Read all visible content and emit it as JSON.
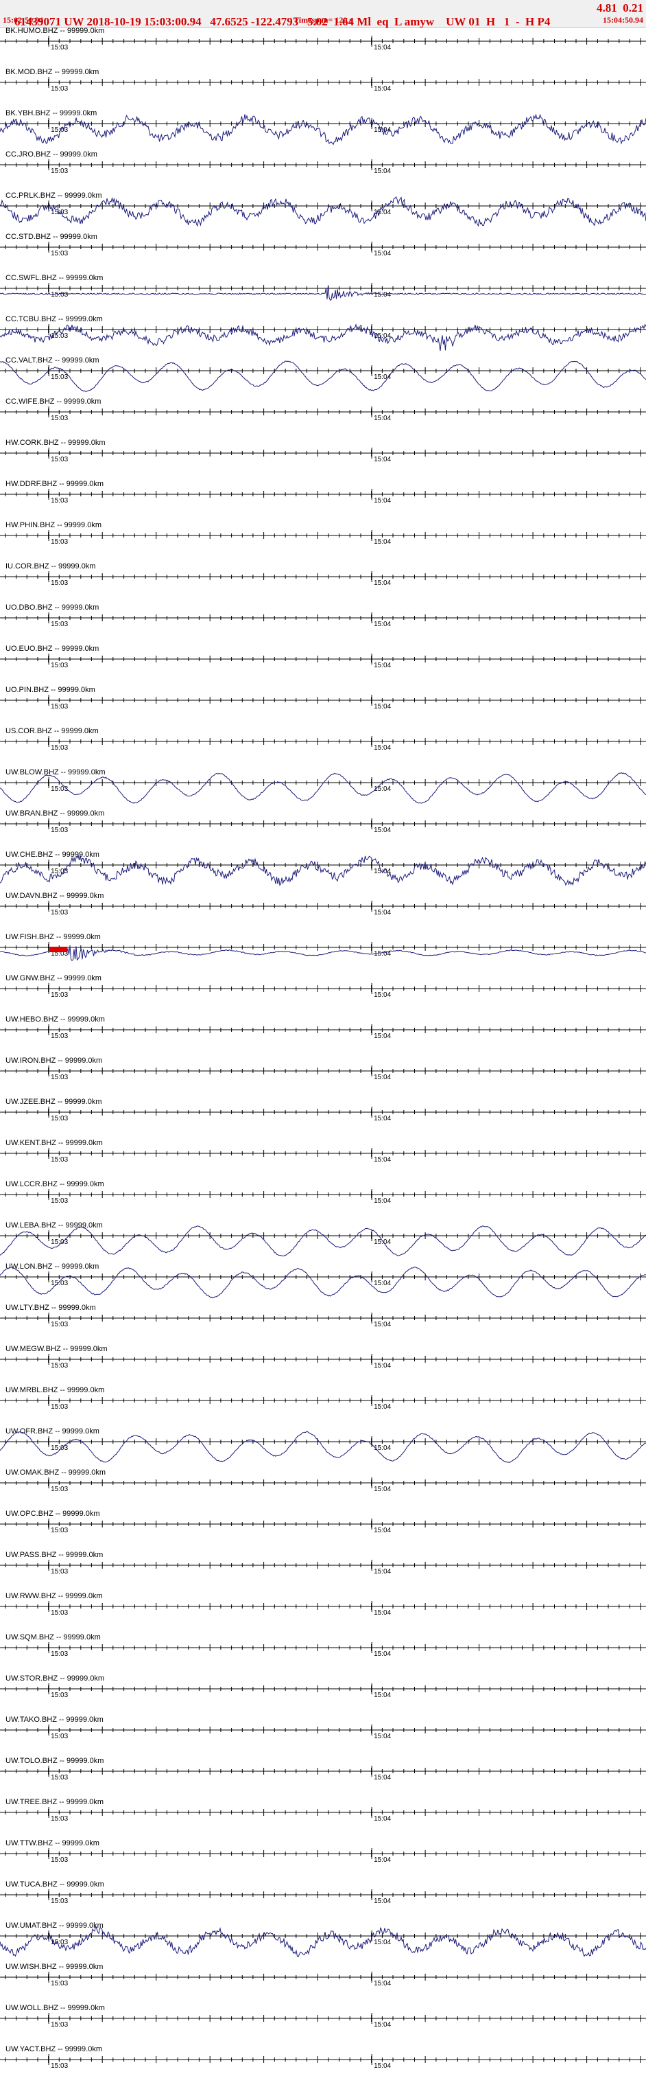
{
  "header": {
    "title": "61439071 UW 2018-10-19 15:03:00.94   47.6525 -122.4793   5.02  1.64 Ml  eq  L amyw    UW 01  H   1  -  H P4",
    "title_right": "4.81  0.21",
    "start_time": "15:02:50.94",
    "timespan": "Timespan= 120 s",
    "end_time": "15:04:50.94"
  },
  "colors": {
    "header_text": "#d40000",
    "trace": "#1a1a7a",
    "axis": "#000000",
    "pick_marker": "#e00000"
  },
  "chart_data": {
    "type": "line",
    "title": "61439071 UW 2018-10-19 15:03:00.94",
    "x_unit": "s",
    "x_range": [
      0,
      120
    ],
    "x_ticks": [
      {
        "label": "15:03",
        "t": 9.06
      },
      {
        "label": "15:04",
        "t": 69.06
      }
    ],
    "panel_count": 50,
    "channels": [
      {
        "label": "BK.HUMO.BHZ -- 99999.0km",
        "signal": "flat"
      },
      {
        "label": "BK.MOD.BHZ -- 99999.0km",
        "signal": "flat"
      },
      {
        "label": "BK.YBH.BHZ -- 99999.0km",
        "signal": "noisy-wave"
      },
      {
        "label": "CC.JRO.BHZ -- 99999.0km",
        "signal": "flat"
      },
      {
        "label": "CC.PRLK.BHZ -- 99999.0km",
        "signal": "noisy-wave"
      },
      {
        "label": "CC.STD.BHZ -- 99999.0km",
        "signal": "flat"
      },
      {
        "label": "CC.SWFL.BHZ -- 99999.0km",
        "signal": "burst",
        "event_t": 61
      },
      {
        "label": "CC.TCBU.BHZ -- 99999.0km",
        "signal": "noisy-wave-burst",
        "event_t": 82
      },
      {
        "label": "CC.VALT.BHZ -- 99999.0km",
        "signal": "smooth-wave"
      },
      {
        "label": "CC.WIFE.BHZ -- 99999.0km",
        "signal": "flat"
      },
      {
        "label": "HW.CORK.BHZ -- 99999.0km",
        "signal": "flat"
      },
      {
        "label": "HW.DDRF.BHZ -- 99999.0km",
        "signal": "flat"
      },
      {
        "label": "HW.PHIN.BHZ -- 99999.0km",
        "signal": "flat"
      },
      {
        "label": "IU.COR.BHZ -- 99999.0km",
        "signal": "flat"
      },
      {
        "label": "UO.DBO.BHZ -- 99999.0km",
        "signal": "flat"
      },
      {
        "label": "UO.EUO.BHZ -- 99999.0km",
        "signal": "flat"
      },
      {
        "label": "UO.PIN.BHZ -- 99999.0km",
        "signal": "flat"
      },
      {
        "label": "US.COR.BHZ -- 99999.0km",
        "signal": "flat"
      },
      {
        "label": "UW.BLOW.BHZ -- 99999.0km",
        "signal": "smooth-wave"
      },
      {
        "label": "UW.BRAN.BHZ -- 99999.0km",
        "signal": "flat"
      },
      {
        "label": "UW.CHE.BHZ -- 99999.0km",
        "signal": "noisy-wave"
      },
      {
        "label": "UW.DAVN.BHZ -- 99999.0km",
        "signal": "flat"
      },
      {
        "label": "UW.FISH.BHZ -- 99999.0km",
        "signal": "pick",
        "event_t": 13
      },
      {
        "label": "UW.GNW.BHZ -- 99999.0km",
        "signal": "flat"
      },
      {
        "label": "UW.HEBO.BHZ -- 99999.0km",
        "signal": "flat"
      },
      {
        "label": "UW.IRON.BHZ -- 99999.0km",
        "signal": "flat"
      },
      {
        "label": "UW.JZEE.BHZ -- 99999.0km",
        "signal": "flat"
      },
      {
        "label": "UW.KENT.BHZ -- 99999.0km",
        "signal": "flat"
      },
      {
        "label": "UW.LCCR.BHZ -- 99999.0km",
        "signal": "flat"
      },
      {
        "label": "UW.LEBA.BHZ -- 99999.0km",
        "signal": "smooth-wave"
      },
      {
        "label": "UW.LON.BHZ -- 99999.0km",
        "signal": "smooth-wave"
      },
      {
        "label": "UW.LTY.BHZ -- 99999.0km",
        "signal": "flat"
      },
      {
        "label": "UW.MEGW.BHZ -- 99999.0km",
        "signal": "flat"
      },
      {
        "label": "UW.MRBL.BHZ -- 99999.0km",
        "signal": "flat"
      },
      {
        "label": "UW.OFR.BHZ -- 99999.0km",
        "signal": "smooth-wave"
      },
      {
        "label": "UW.OMAK.BHZ -- 99999.0km",
        "signal": "flat"
      },
      {
        "label": "UW.OPC.BHZ -- 99999.0km",
        "signal": "flat"
      },
      {
        "label": "UW.PASS.BHZ -- 99999.0km",
        "signal": "flat"
      },
      {
        "label": "UW.RWW.BHZ -- 99999.0km",
        "signal": "flat"
      },
      {
        "label": "UW.SQM.BHZ -- 99999.0km",
        "signal": "flat"
      },
      {
        "label": "UW.STOR.BHZ -- 99999.0km",
        "signal": "flat"
      },
      {
        "label": "UW.TAKO.BHZ -- 99999.0km",
        "signal": "flat"
      },
      {
        "label": "UW.TOLO.BHZ -- 99999.0km",
        "signal": "flat"
      },
      {
        "label": "UW.TREE.BHZ -- 99999.0km",
        "signal": "flat"
      },
      {
        "label": "UW.TTW.BHZ -- 99999.0km",
        "signal": "flat"
      },
      {
        "label": "UW.TUCA.BHZ -- 99999.0km",
        "signal": "flat"
      },
      {
        "label": "UW.UMAT.BHZ -- 99999.0km",
        "signal": "noisy-wave"
      },
      {
        "label": "UW.WISH.BHZ -- 99999.0km",
        "signal": "flat"
      },
      {
        "label": "UW.WOLL.BHZ -- 99999.0km",
        "signal": "flat"
      },
      {
        "label": "UW.YACT.BHZ -- 99999.0km",
        "signal": "flat"
      }
    ]
  }
}
